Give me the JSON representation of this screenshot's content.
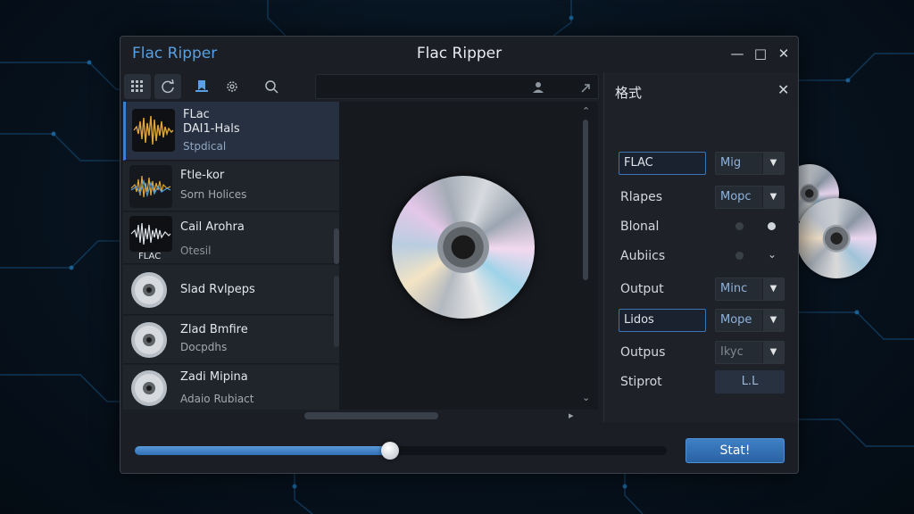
{
  "window": {
    "app_name": "Flac  Ripper",
    "title": "Flac Ripper"
  },
  "toolbar": {
    "buttons": [
      "grid-icon",
      "refresh-icon",
      "bookmark-icon",
      "settings-icon",
      "search-icon"
    ],
    "search_actions": [
      "user-icon",
      "arrow-icon"
    ]
  },
  "tracks": [
    {
      "line1": "FLac",
      "line2": "DAI1-Hals",
      "line3": "Stpdical",
      "selected": true
    },
    {
      "line1": "Ftle-kor",
      "line2": "Sorn Holices"
    },
    {
      "line1": "Cail Arohra",
      "line2": "Otesil",
      "badge": "FLAC"
    },
    {
      "line1": "Slad Rvlpeps"
    },
    {
      "line1": "Zlad Bmfire",
      "line2": "Docpdhs"
    },
    {
      "line1": "Zadi Mipina",
      "line2": "Adaio Rubiact"
    }
  ],
  "panel": {
    "title": "格式",
    "rows": [
      {
        "label": "FLAC",
        "select": "Mig",
        "kind": "input-select"
      },
      {
        "label": "Rlapes",
        "select": "Mopc",
        "kind": "select"
      },
      {
        "label": "Blonal",
        "kind": "dots"
      },
      {
        "label": "Aubiics",
        "kind": "dot-chevron"
      },
      {
        "label": "Output",
        "select": "Minc",
        "kind": "select"
      },
      {
        "label": "Lidos",
        "select": "Mope",
        "kind": "input-select"
      },
      {
        "label": "Outpus",
        "select": "Ikyc",
        "kind": "select"
      },
      {
        "label": "Stiprot",
        "field": "L.L",
        "kind": "field"
      }
    ]
  },
  "progress": {
    "value": 0.48
  },
  "start_button": "Stat!",
  "colors": {
    "accent": "#3c7fd0",
    "background": "#07131f",
    "window": "#1b1f25"
  }
}
